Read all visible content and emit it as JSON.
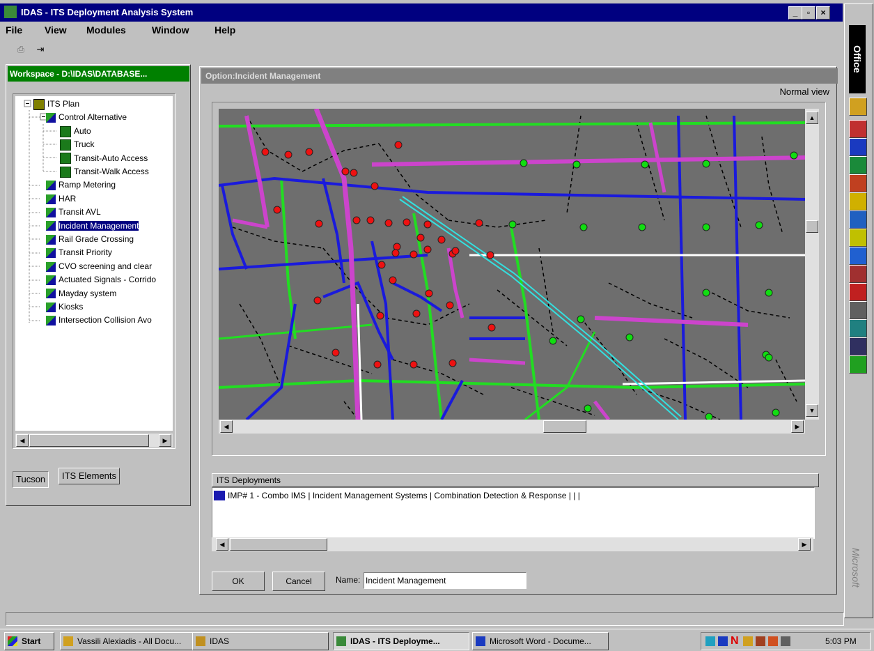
{
  "app": {
    "title": "IDAS - ITS Deployment Analysis System",
    "window_buttons": [
      "_",
      "×"
    ]
  },
  "menu": [
    "File",
    "View",
    "Modules",
    "Window",
    "Help"
  ],
  "workspace": {
    "title": "Workspace - D:\\IDAS\\DATABASE...",
    "tree": [
      {
        "label": "ITS Plan",
        "level": 0,
        "icon": "plan-icon"
      },
      {
        "label": "Control Alternative",
        "level": 1,
        "icon": "alternative-icon"
      },
      {
        "label": "Auto",
        "level": 2,
        "icon": "leaf-icon"
      },
      {
        "label": "Truck",
        "level": 2,
        "icon": "leaf-icon"
      },
      {
        "label": "Transit-Auto Access",
        "level": 2,
        "icon": "leaf-icon"
      },
      {
        "label": "Transit-Walk Access",
        "level": 2,
        "icon": "leaf-icon"
      },
      {
        "label": "Ramp Metering",
        "level": 1,
        "icon": "alternative-icon"
      },
      {
        "label": "HAR",
        "level": 1,
        "icon": "alternative-icon"
      },
      {
        "label": "Transit AVL",
        "level": 1,
        "icon": "alternative-icon"
      },
      {
        "label": "Incident Management",
        "level": 1,
        "icon": "alternative-icon",
        "selected": true
      },
      {
        "label": "Rail Grade Crossing",
        "level": 1,
        "icon": "alternative-icon"
      },
      {
        "label": "Transit Priority",
        "level": 1,
        "icon": "alternative-icon"
      },
      {
        "label": "CVO screening and clear",
        "level": 1,
        "icon": "alternative-icon"
      },
      {
        "label": "Actuated Signals - Corrido",
        "level": 1,
        "icon": "alternative-icon"
      },
      {
        "label": "Mayday system",
        "level": 1,
        "icon": "alternative-icon"
      },
      {
        "label": "Kiosks",
        "level": 1,
        "icon": "alternative-icon"
      },
      {
        "label": "Intersection Collision Avo",
        "level": 1,
        "icon": "alternative-icon"
      }
    ],
    "tabs": [
      "Tucson",
      "ITS Elements"
    ]
  },
  "option": {
    "title": "Option:Incident Management",
    "view_label": "Normal view",
    "deployments_header": "ITS Deployments",
    "deployment_rows": [
      "IMP#   1 - Combo IMS | Incident Management Systems | Combination Detection & Response |  |  |"
    ],
    "ok_label": "OK",
    "cancel_label": "Cancel",
    "name_label": "Name:",
    "name_value": "Incident Management"
  },
  "office_bar": {
    "label": "Office",
    "footer": "Microsoft",
    "icons": [
      "office-icon",
      "binder-icon",
      "word-icon",
      "excel-icon",
      "powerpoint-icon",
      "key-icon",
      "find-icon",
      "sun-icon",
      "ie-icon",
      "mixed-icon",
      "acrobat-icon",
      "clipboard-icon",
      "face-icon",
      "tools-icon",
      "green-icon"
    ]
  },
  "taskbar": {
    "start": "Start",
    "tasks": [
      "Vassili Alexiadis - All Docu...",
      "IDAS",
      "IDAS - ITS Deployme...",
      "Microsoft Word - Docume..."
    ],
    "time": "5:03 PM"
  },
  "colors": {
    "title_blue": "#000080",
    "workspace_green": "#008000",
    "map_bg": "#6e6e6e",
    "road_blue": "#1a1adc",
    "road_green": "#22dd22",
    "road_magenta": "#cc44cc",
    "road_white": "#ffffff",
    "node_red": "#ee1111",
    "node_green": "#11dd11",
    "road_cyan": "#33e0e0"
  }
}
